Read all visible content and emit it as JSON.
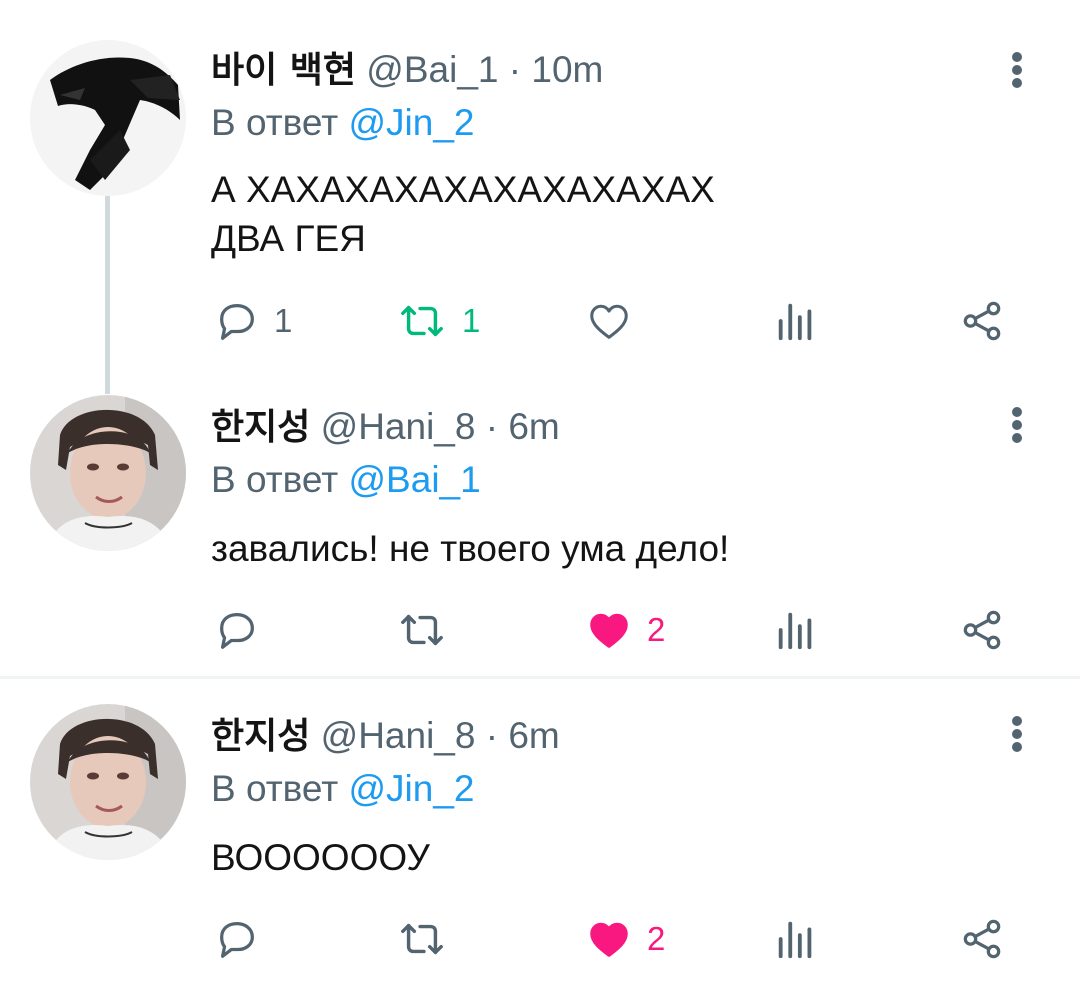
{
  "tweets": [
    {
      "name": "바이 백현",
      "handle": "@Bai_1",
      "separator": "·",
      "time": "10m",
      "reply_prefix": "В ответ",
      "reply_to": "@Jin_2",
      "text": "А ХАХАХАХАХАХАХАХАХАХ\nДВА ГЕЯ",
      "reply_count": "1",
      "retweet_count": "1",
      "like_count": "",
      "retweeted": true,
      "liked": false
    },
    {
      "name": "한지성",
      "handle": "@Hani_8",
      "separator": "·",
      "time": "6m",
      "reply_prefix": "В ответ",
      "reply_to": "@Bai_1",
      "text": "завались! не твоего ума дело!",
      "reply_count": "",
      "retweet_count": "",
      "like_count": "2",
      "retweeted": false,
      "liked": true
    },
    {
      "name": "한지성",
      "handle": "@Hani_8",
      "separator": "·",
      "time": "6m",
      "reply_prefix": "В ответ",
      "reply_to": "@Jin_2",
      "text": "ВООООООУ",
      "reply_count": "",
      "retweet_count": "",
      "like_count": "2",
      "retweeted": false,
      "liked": true
    }
  ],
  "colors": {
    "text": "#141414",
    "secondary": "#536471",
    "mention": "#1d9bf0",
    "retweet_active": "#00ba7c",
    "like_active": "#f91880",
    "thread_line": "#cfd9de"
  },
  "icons": [
    "more-vertical-icon",
    "reply-icon",
    "retweet-icon",
    "like-icon",
    "analytics-icon",
    "share-icon"
  ]
}
